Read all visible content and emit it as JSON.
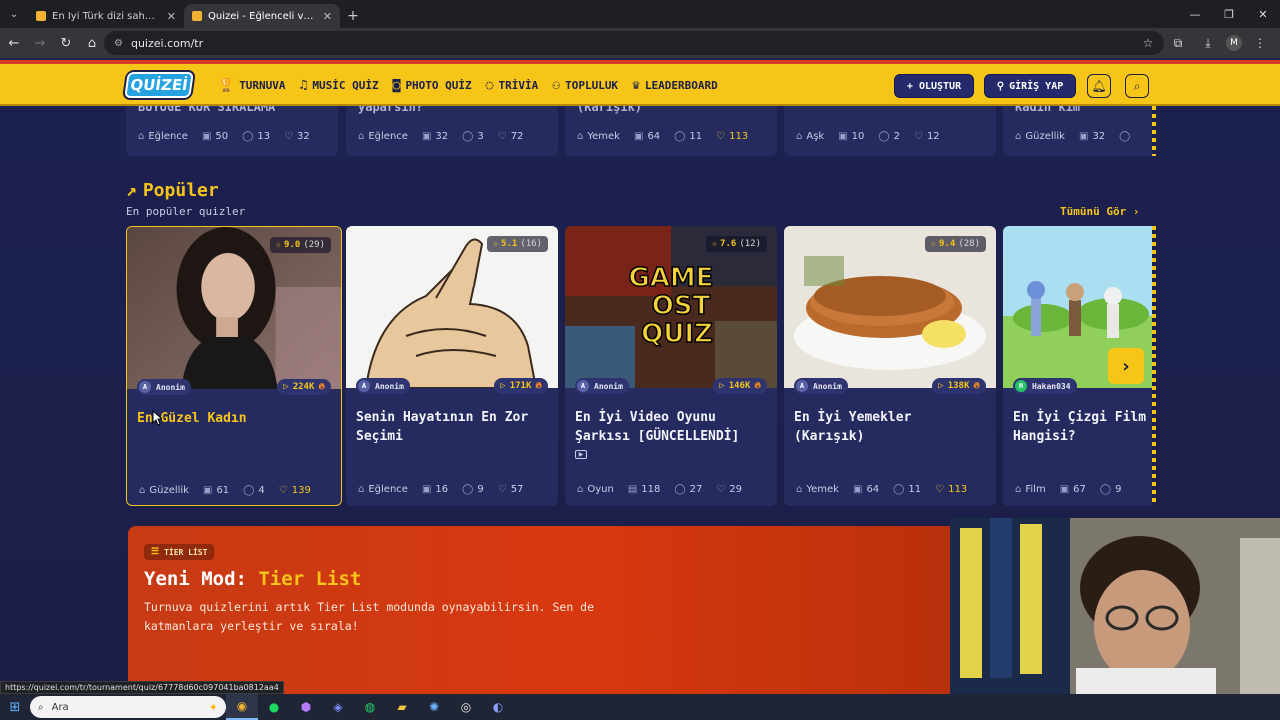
{
  "browser": {
    "tabs": [
      {
        "title": "En İyi Türk dizi sahnesi - Tier List",
        "active": false
      },
      {
        "title": "Quizei - Eğlenceli ve etkileşimli",
        "active": true
      }
    ],
    "url": "quizei.com/tr",
    "status_link": "https://quizei.com/tr/tournament/quiz/67778d60c097041ba0812aa4"
  },
  "header": {
    "logo": "QUİZEİ",
    "nav": [
      {
        "label": "TURNUVA",
        "icon": "trophy-icon"
      },
      {
        "label": "MUSİC QUİZ",
        "icon": "music-icon"
      },
      {
        "label": "PHOTO QUİZ",
        "icon": "camera-icon"
      },
      {
        "label": "TRİVİA",
        "icon": "chat-icon"
      },
      {
        "label": "TOPLULUK",
        "icon": "users-icon"
      },
      {
        "label": "LEADERBOARD",
        "icon": "crown-icon"
      }
    ],
    "create_label": "+ OLUŞTUR",
    "login_label": "GİRİŞ YAP"
  },
  "top_row": [
    {
      "title": "BÜYÜĞE KÜR SIRALAMA",
      "category": "Eğlence",
      "questions": "50",
      "comments": "13",
      "likes": "32",
      "hot": false
    },
    {
      "title": "yaparsın?",
      "category": "Eğlence",
      "questions": "32",
      "comments": "3",
      "likes": "72",
      "hot": false
    },
    {
      "title": "(Karışık)",
      "category": "Yemek",
      "questions": "64",
      "comments": "11",
      "likes": "113",
      "hot": true
    },
    {
      "title": "",
      "category": "Aşk",
      "questions": "10",
      "comments": "2",
      "likes": "12",
      "hot": false
    },
    {
      "title": "Kadın kim",
      "category": "Güzellik",
      "questions": "32",
      "comments": "",
      "likes": "",
      "hot": false
    }
  ],
  "popular": {
    "title": "Popüler",
    "subtitle": "En popüler quizler",
    "see_all": "Tümünü Gör ›",
    "cards": [
      {
        "rating": "9.0",
        "rating_count": "(29)",
        "author": "Anonim",
        "author_initial": "A",
        "plays": "224K",
        "title": "En Güzel Kadın",
        "category": "Güzellik",
        "questions": "61",
        "comments": "4",
        "likes": "139",
        "hot": true
      },
      {
        "rating": "5.1",
        "rating_count": "(16)",
        "author": "Anonim",
        "author_initial": "A",
        "plays": "171K",
        "title": "Senin Hayatının En Zor Seçimi",
        "category": "Eğlence",
        "questions": "16",
        "comments": "9",
        "likes": "57",
        "hot": false
      },
      {
        "rating": "7.6",
        "rating_count": "(12)",
        "author": "Anonim",
        "author_initial": "A",
        "plays": "146K",
        "title": "En İyi Video Oyunu Şarkısı [GÜNCELLENDİ]",
        "category": "Oyun",
        "questions": "118",
        "comments": "27",
        "likes": "29",
        "hot": false
      },
      {
        "rating": "9.4",
        "rating_count": "(28)",
        "author": "Anonim",
        "author_initial": "A",
        "plays": "138K",
        "title": "En İyi Yemekler (Karışık)",
        "category": "Yemek",
        "questions": "64",
        "comments": "11",
        "likes": "113",
        "hot": true
      },
      {
        "rating": "",
        "rating_count": "",
        "author": "Hakan034",
        "author_initial": "H",
        "plays": "",
        "title": "En İyi Çizgi Film Hangisi?",
        "category": "Film",
        "questions": "67",
        "comments": "9",
        "likes": "",
        "hot": false
      }
    ],
    "game_thumb_text": "GAME OST QUIZ"
  },
  "banner": {
    "badge": "TİER LİST",
    "title_prefix": "Yeni Mod: ",
    "title_highlight": "Tier List",
    "description": "Turnuva quizlerini artık Tier List modunda oynayabilirsin. Sen de katmanlara yerleştir ve sırala!"
  },
  "taskbar": {
    "search_placeholder": "Ara"
  },
  "colors": {
    "accent": "#f6c518",
    "header_bg": "#f6c518",
    "page_bg": "#1d2150",
    "card_bg": "#262b5f",
    "banner_bg": "#d8380f"
  }
}
